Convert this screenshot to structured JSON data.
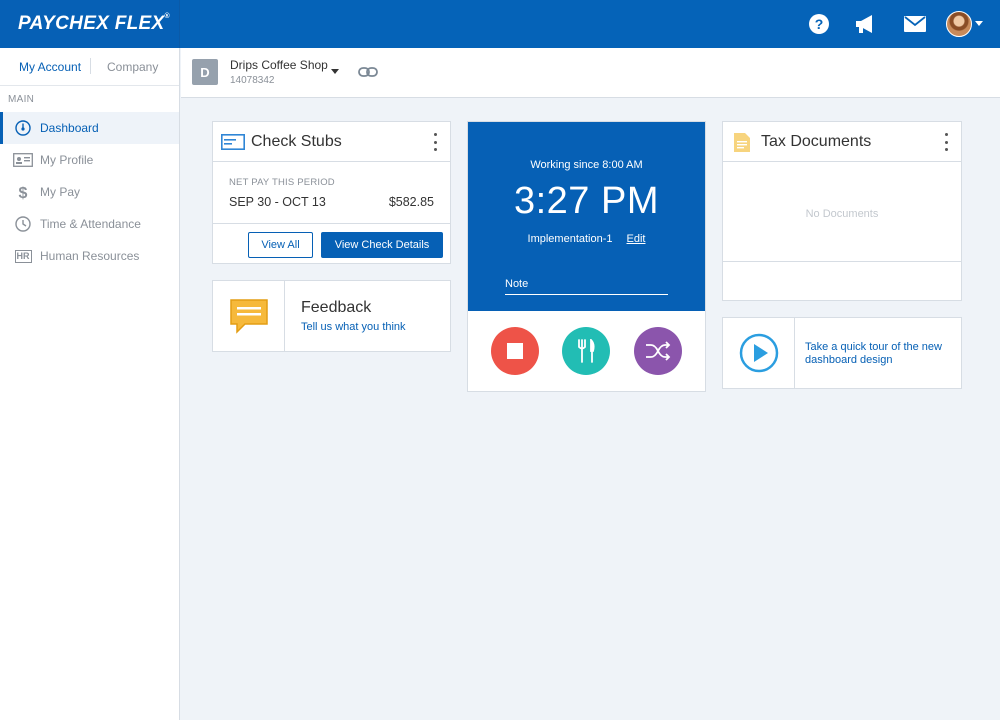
{
  "header": {
    "logo": "PAYCHEX FLEX",
    "logo_mark": "®",
    "icons": [
      "help-icon",
      "megaphone-icon",
      "mail-icon"
    ]
  },
  "sidebar": {
    "tabs": {
      "active": "My Account",
      "inactive": "Company"
    },
    "section_label": "MAIN",
    "items": [
      {
        "label": "Dashboard",
        "icon": "dashboard-icon"
      },
      {
        "label": "My Profile",
        "icon": "id-card-icon"
      },
      {
        "label": "My Pay",
        "icon": "dollar-icon"
      },
      {
        "label": "Time & Attendance",
        "icon": "clock-icon"
      },
      {
        "label": "Human Resources",
        "icon": "hr-icon"
      }
    ],
    "hr_icon_text": "HR"
  },
  "company": {
    "badge": "D",
    "name": "Drips Coffee Shop",
    "id": "14078342"
  },
  "check_stubs": {
    "title": "Check Stubs",
    "net_label": "NET PAY THIS PERIOD",
    "period": "SEP 30 - OCT 13",
    "amount": "$582.85",
    "view_all": "View All",
    "view_details": "View Check Details"
  },
  "feedback": {
    "title": "Feedback",
    "subtitle": "Tell us what you think"
  },
  "clock": {
    "working_since": "Working since 8:00 AM",
    "time": "3:27 PM",
    "job": "Implementation-1",
    "edit": "Edit",
    "note_placeholder": "Note",
    "colors": {
      "stop": "#ee5348",
      "meal": "#22bdb4",
      "transfer": "#8b55ac"
    }
  },
  "tax_documents": {
    "title": "Tax Documents",
    "empty": "No Documents"
  },
  "tour": {
    "text": "Take a quick tour of the new dashboard design"
  },
  "colors": {
    "brand": "#0660b5",
    "background": "#eff3f8"
  }
}
